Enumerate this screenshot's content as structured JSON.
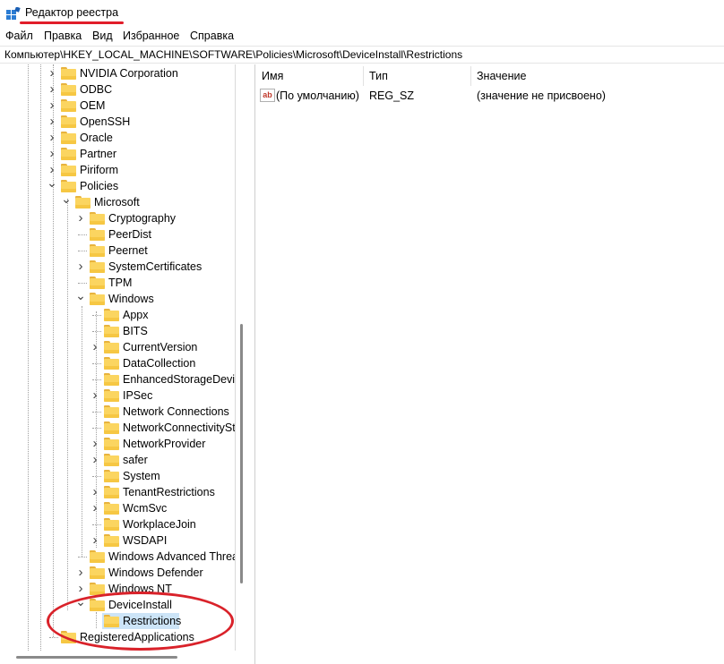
{
  "window": {
    "title": "Редактор реестра"
  },
  "menu": [
    "Файл",
    "Правка",
    "Вид",
    "Избранное",
    "Справка"
  ],
  "address": "Компьютер\\HKEY_LOCAL_MACHINE\\SOFTWARE\\Policies\\Microsoft\\DeviceInstall\\Restrictions",
  "tree": [
    {
      "label": "NVIDIA Corporation",
      "level": 0,
      "expander": "collapsed",
      "name": "tree-item-nvidia-corporation"
    },
    {
      "label": "ODBC",
      "level": 0,
      "expander": "collapsed",
      "name": "tree-item-odbc"
    },
    {
      "label": "OEM",
      "level": 0,
      "expander": "collapsed",
      "name": "tree-item-oem"
    },
    {
      "label": "OpenSSH",
      "level": 0,
      "expander": "collapsed",
      "name": "tree-item-openssh"
    },
    {
      "label": "Oracle",
      "level": 0,
      "expander": "collapsed",
      "name": "tree-item-oracle"
    },
    {
      "label": "Partner",
      "level": 0,
      "expander": "collapsed",
      "name": "tree-item-partner"
    },
    {
      "label": "Piriform",
      "level": 0,
      "expander": "collapsed",
      "name": "tree-item-piriform"
    },
    {
      "label": "Policies",
      "level": 0,
      "expander": "expanded",
      "name": "tree-item-policies"
    },
    {
      "label": "Microsoft",
      "level": 1,
      "expander": "expanded",
      "name": "tree-item-microsoft"
    },
    {
      "label": "Cryptography",
      "level": 2,
      "expander": "collapsed",
      "name": "tree-item-cryptography"
    },
    {
      "label": "PeerDist",
      "level": 2,
      "expander": "none",
      "name": "tree-item-peerdist"
    },
    {
      "label": "Peernet",
      "level": 2,
      "expander": "none",
      "name": "tree-item-peernet"
    },
    {
      "label": "SystemCertificates",
      "level": 2,
      "expander": "collapsed",
      "name": "tree-item-systemcertificates"
    },
    {
      "label": "TPM",
      "level": 2,
      "expander": "none",
      "name": "tree-item-tpm"
    },
    {
      "label": "Windows",
      "level": 2,
      "expander": "expanded",
      "name": "tree-item-windows"
    },
    {
      "label": "Appx",
      "level": 3,
      "expander": "none",
      "name": "tree-item-appx"
    },
    {
      "label": "BITS",
      "level": 3,
      "expander": "none",
      "name": "tree-item-bits"
    },
    {
      "label": "CurrentVersion",
      "level": 3,
      "expander": "collapsed",
      "name": "tree-item-currentversion"
    },
    {
      "label": "DataCollection",
      "level": 3,
      "expander": "none",
      "name": "tree-item-datacollection"
    },
    {
      "label": "EnhancedStorageDevices",
      "level": 3,
      "expander": "none",
      "name": "tree-item-enhancedstoragedevices"
    },
    {
      "label": "IPSec",
      "level": 3,
      "expander": "collapsed",
      "name": "tree-item-ipsec"
    },
    {
      "label": "Network Connections",
      "level": 3,
      "expander": "none",
      "name": "tree-item-network-connections"
    },
    {
      "label": "NetworkConnectivityStatusIndicator",
      "level": 3,
      "expander": "none",
      "name": "tree-item-networkconnectivitystatusindicator"
    },
    {
      "label": "NetworkProvider",
      "level": 3,
      "expander": "collapsed",
      "name": "tree-item-networkprovider"
    },
    {
      "label": "safer",
      "level": 3,
      "expander": "collapsed",
      "name": "tree-item-safer"
    },
    {
      "label": "System",
      "level": 3,
      "expander": "none",
      "name": "tree-item-system"
    },
    {
      "label": "TenantRestrictions",
      "level": 3,
      "expander": "collapsed",
      "name": "tree-item-tenantrestrictions"
    },
    {
      "label": "WcmSvc",
      "level": 3,
      "expander": "collapsed",
      "name": "tree-item-wcmsvc"
    },
    {
      "label": "WorkplaceJoin",
      "level": 3,
      "expander": "none",
      "name": "tree-item-workplacejoin"
    },
    {
      "label": "WSDAPI",
      "level": 3,
      "expander": "collapsed",
      "name": "tree-item-wsdapi"
    },
    {
      "label": "Windows Advanced Threat Protection",
      "level": 2,
      "expander": "none",
      "name": "tree-item-windows-advanced-threat-protection"
    },
    {
      "label": "Windows Defender",
      "level": 2,
      "expander": "collapsed",
      "name": "tree-item-windows-defender"
    },
    {
      "label": "Windows NT",
      "level": 2,
      "expander": "collapsed",
      "name": "tree-item-windows-nt"
    },
    {
      "label": "DeviceInstall",
      "level": 2,
      "expander": "expanded",
      "name": "tree-item-deviceinstall"
    },
    {
      "label": "Restrictions",
      "level": 3,
      "expander": "none",
      "selected": true,
      "name": "tree-item-restrictions"
    },
    {
      "label": "RegisteredApplications",
      "level": 0,
      "expander": "none",
      "name": "tree-item-registeredapplications"
    }
  ],
  "values": {
    "headers": {
      "name": "Имя",
      "type": "Тип",
      "data": "Значение"
    },
    "rows": [
      {
        "name": "(По умолчанию)",
        "type": "REG_SZ",
        "data": "(значение не присвоено)",
        "icon": "ab-string-icon"
      }
    ]
  },
  "colors": {
    "selection": "#cce4f7",
    "annotation": "#d9222a",
    "folder": "#fbd560"
  }
}
